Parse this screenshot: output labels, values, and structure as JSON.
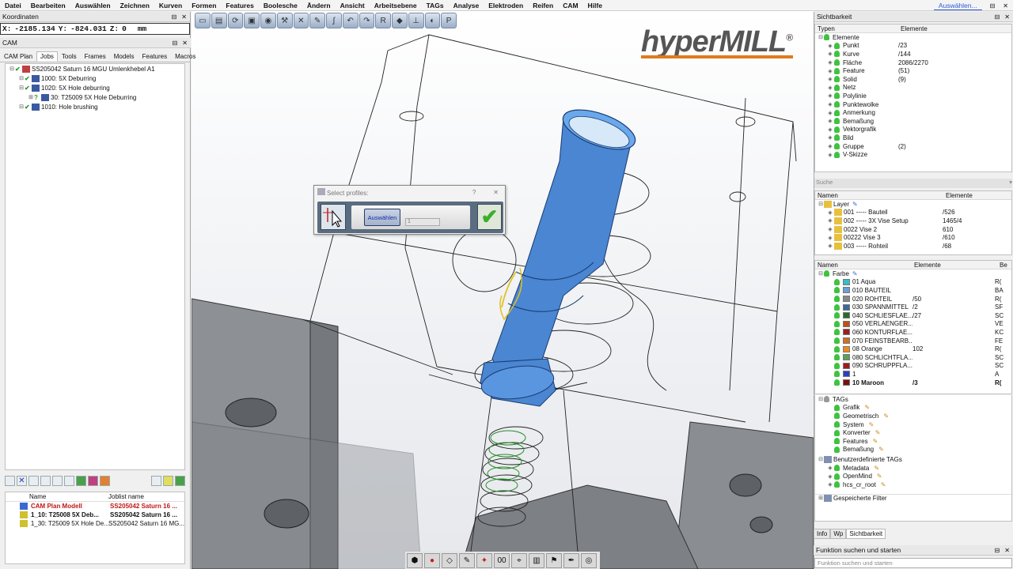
{
  "menu": [
    "Datei",
    "Bearbeiten",
    "Auswählen",
    "Zeichnen",
    "Kurven",
    "Formen",
    "Features",
    "Boolesche",
    "Ändern",
    "Ansicht",
    "Arbeitsebene",
    "TAGs",
    "Analyse",
    "Elektroden",
    "Reifen",
    "CAM",
    "Hilfe"
  ],
  "menu_right": "Auswählen...",
  "coords": {
    "title": "Koordinaten",
    "x_label": "X:",
    "x": "-2185.134",
    "y_label": "Y:",
    "y": "-824.031",
    "z_label": "Z:",
    "z": "0",
    "unit": "mm"
  },
  "cam": {
    "title": "CAM",
    "tabs": [
      "CAM Plan",
      "Jobs",
      "Tools",
      "Frames",
      "Models",
      "Features",
      "Macros"
    ],
    "active_tab": "Jobs",
    "tree": [
      {
        "label": "SS205042 Saturn 16 MGU Umlenkhebel A1",
        "indent": 0
      },
      {
        "label": "1000: 5X Deburring",
        "indent": 1
      },
      {
        "label": "1020: 5X Hole deburring",
        "indent": 1
      },
      {
        "label": "30: T25009 5X Hole Deburring",
        "indent": 2
      },
      {
        "label": "1010: Hole brushing",
        "indent": 1
      }
    ],
    "joblist": {
      "col_name": "Name",
      "col_joblist": "Joblist name",
      "rows": [
        {
          "name": "CAM Plan Modell",
          "joblist": "SS205042 Saturn 16 ...",
          "style": "red"
        },
        {
          "name": "1_10: T25008 5X Deb...",
          "joblist": "SS205042 Saturn 16 ...",
          "style": "bold"
        },
        {
          "name": "1_30: T25009 5X Hole De...",
          "joblist": "SS205042 Saturn 16 MG...",
          "style": "normal"
        }
      ]
    }
  },
  "logo": {
    "text": "hyperMILL",
    "reg": "®",
    "accent": "#e07a1e"
  },
  "dialog": {
    "title": "Select profiles:",
    "help": "?",
    "close": "✕",
    "select_label": "Auswählen",
    "count": "1",
    "ok": "✔"
  },
  "sichtbarkeit": {
    "title": "Sichtbarkeit",
    "col_types": "Typen",
    "col_elements": "Elemente",
    "root": "Elemente",
    "rows": [
      {
        "label": "Punkt",
        "value": "/23"
      },
      {
        "label": "Kurve",
        "value": "/144"
      },
      {
        "label": "Fläche",
        "value": "2086/2270"
      },
      {
        "label": "Feature",
        "value": "(51)"
      },
      {
        "label": "Solid",
        "value": "(9)"
      },
      {
        "label": "Netz",
        "value": ""
      },
      {
        "label": "Polylinie",
        "value": ""
      },
      {
        "label": "Punktewolke",
        "value": ""
      },
      {
        "label": "Anmerkung",
        "value": ""
      },
      {
        "label": "Bemaßung",
        "value": ""
      },
      {
        "label": "Vektorgrafik",
        "value": ""
      },
      {
        "label": "Bild",
        "value": ""
      },
      {
        "label": "Gruppe",
        "value": "(2)"
      },
      {
        "label": "V-Skizze",
        "value": ""
      }
    ]
  },
  "suche": {
    "title": "Suche"
  },
  "layer": {
    "col_name": "Namen",
    "col_elements": "Elemente",
    "root": "Layer",
    "rows": [
      {
        "label": "001 ----- Bauteil",
        "value": "/526"
      },
      {
        "label": "002 ----- 3X Vise Setup",
        "value": "1465/4"
      },
      {
        "label": "0022 Vise 2",
        "value": "610"
      },
      {
        "label": "00222 Vise 3",
        "value": "/610"
      },
      {
        "label": "003 ----- Rohteil",
        "value": "/68"
      }
    ]
  },
  "farbe": {
    "col_name": "Namen",
    "col_elements": "Elemente",
    "col_extra": "Be",
    "root": "Farbe",
    "rows": [
      {
        "label": "01 Aqua",
        "value": "",
        "x": "R(",
        "color": "#33c0c8"
      },
      {
        "label": "010 BAUTEIL",
        "value": "",
        "x": "BA",
        "color": "#6aa0d8"
      },
      {
        "label": "020 ROHTEIL",
        "value": "/50",
        "x": "R(",
        "color": "#888888"
      },
      {
        "label": "030 SPANNMITTEL",
        "value": "/2",
        "x": "SF",
        "color": "#3a6aa0"
      },
      {
        "label": "040 SCHLIESFLAE...",
        "value": "/27",
        "x": "SC",
        "color": "#2a6a2a"
      },
      {
        "label": "050 VERLAENGER...",
        "value": "",
        "x": "VE",
        "color": "#c05010"
      },
      {
        "label": "060 KONTURFLAE...",
        "value": "",
        "x": "KC",
        "color": "#9a2020"
      },
      {
        "label": "070 FEINSTBEARB...",
        "value": "",
        "x": "FE",
        "color": "#d07020"
      },
      {
        "label": "08 Orange",
        "value": "102",
        "x": "R(",
        "color": "#f08a1a"
      },
      {
        "label": "080 SCHLICHTFLA...",
        "value": "",
        "x": "SC",
        "color": "#5aa05a"
      },
      {
        "label": "090 SCHRUPPFLA...",
        "value": "",
        "x": "SC",
        "color": "#a01a1a"
      },
      {
        "label": "1",
        "value": "",
        "x": "A",
        "color": "#2a40c0"
      },
      {
        "label": "10 Maroon",
        "value": "/3",
        "x": "R(",
        "color": "#7a1010"
      }
    ]
  },
  "tags": {
    "root": "TAGs",
    "items": [
      "Grafik",
      "Geometrisch",
      "System",
      "Konverter",
      "Features",
      "Bemaßung"
    ],
    "custom_root": "Benutzerdefinierte TAGs",
    "custom_items": [
      "Metadata",
      "OpenMind",
      "hcs_cr_root"
    ],
    "saved_filter": "Gespeicherte Filter"
  },
  "bottom_tabs": [
    "Info",
    "Wp",
    "Sichtbarkeit"
  ],
  "func": {
    "title": "Funktion suchen und starten",
    "placeholder": "Funktion suchen und starten"
  },
  "panel_ctrls": {
    "pin": "⊟",
    "close": "✕"
  },
  "colors": {
    "model_blue": "#4a86d2",
    "model_light": "#7ab0ee",
    "grey_surface": "#8a8d92",
    "accent_orange": "#e07a1e"
  }
}
